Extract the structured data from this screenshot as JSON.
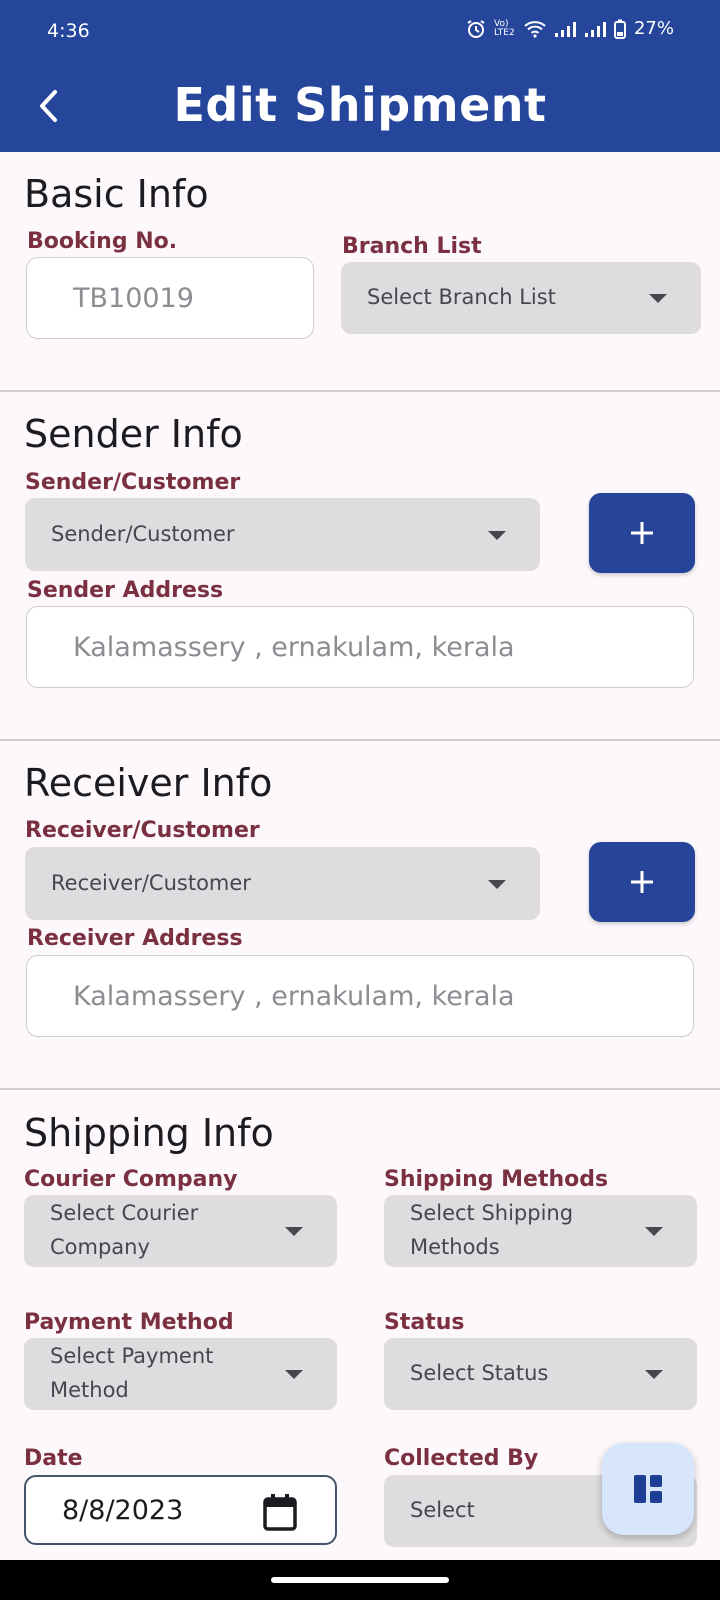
{
  "status_bar": {
    "time": "4:36",
    "network_label": "Vo) LTE2",
    "battery": "27%"
  },
  "app_bar": {
    "title": "Edit Shipment",
    "back_icon": "arrow-back-icon"
  },
  "basic_info": {
    "title": "Basic Info",
    "booking_label": "Booking No.",
    "booking_value": "TB10019",
    "branch_label": "Branch List",
    "branch_value": "Select Branch List"
  },
  "sender_info": {
    "title": "Sender Info",
    "customer_label": "Sender/Customer",
    "customer_value": "Sender/Customer",
    "address_label": "Sender Address",
    "address_value": "Kalamassery , ernakulam, kerala",
    "add_icon": "plus-icon"
  },
  "receiver_info": {
    "title": "Receiver Info",
    "customer_label": "Receiver/Customer",
    "customer_value": "Receiver/Customer",
    "address_label": "Receiver  Address",
    "address_value": "Kalamassery , ernakulam, kerala",
    "add_icon": "plus-icon"
  },
  "shipping_info": {
    "title": "Shipping Info",
    "courier_label": "Courier Company",
    "courier_value": "Select Courier Company",
    "method_label": "Shipping Methods",
    "method_value": "Select Shipping Methods",
    "payment_label": "Payment Method",
    "payment_value": "Select Payment Method",
    "status_label": "Status",
    "status_value": "Select Status",
    "date_label": "Date",
    "date_value": "8/8/2023",
    "collected_label": "Collected By",
    "collected_value": "Select"
  },
  "fab": {
    "icon": "dashboard-icon"
  },
  "colors": {
    "primary": "#26469c",
    "label": "#7a3040",
    "dropdown_bg": "#dedcde",
    "fab_bg": "#d8e6fb"
  }
}
